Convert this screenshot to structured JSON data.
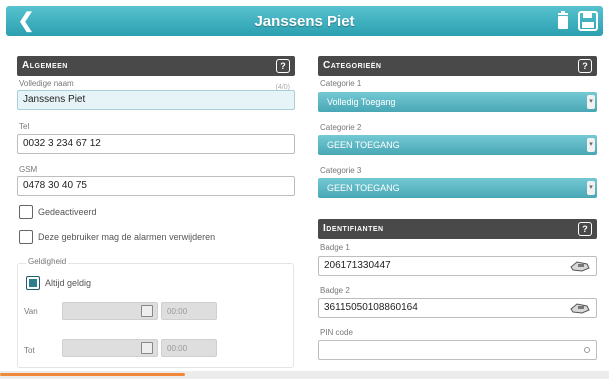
{
  "topbar": {
    "title": "Janssens Piet",
    "back_icon": "chevron-left-icon",
    "delete_icon": "trash-icon",
    "save_icon": "save-icon",
    "color": "#3aaebe"
  },
  "algemeen": {
    "title": "Algemeen",
    "help": "?",
    "full_name_label": "Volledige naam",
    "full_name_counter": "(4/0)",
    "full_name_value": "Janssens Piet",
    "tel_label": "Tel",
    "tel_value": "0032 3 234 67 12",
    "gsm_label": "GSM",
    "gsm_value": "0478 30 40 75",
    "deactivated_label": "Gedeactiveerd",
    "deactivated_checked": false,
    "can_delete_alarms_label": "Deze gebruiker mag de alarmen verwijderen",
    "can_delete_alarms_checked": false,
    "validity": {
      "title": "Geldigheid",
      "always_valid_label": "Altijd geldig",
      "always_valid_checked": true,
      "from_label": "Van",
      "from_time": "00:00",
      "to_label": "Tot",
      "to_time": "00:00"
    }
  },
  "categorieen": {
    "title": "Categorieën",
    "help": "?",
    "items": [
      {
        "label": "Categorie 1",
        "value": "Volledig Toegang"
      },
      {
        "label": "Categorie 2",
        "value": "GEEN TOEGANG"
      },
      {
        "label": "Categorie 3",
        "value": "GEEN TOEGANG"
      }
    ]
  },
  "identifianten": {
    "title": "Identifianten",
    "help": "?",
    "badge1_label": "Badge 1",
    "badge1_value": "206171330447",
    "badge2_label": "Badge 2",
    "badge2_value": "36115050108860164",
    "pin_label": "PIN code",
    "pin_value": ""
  }
}
